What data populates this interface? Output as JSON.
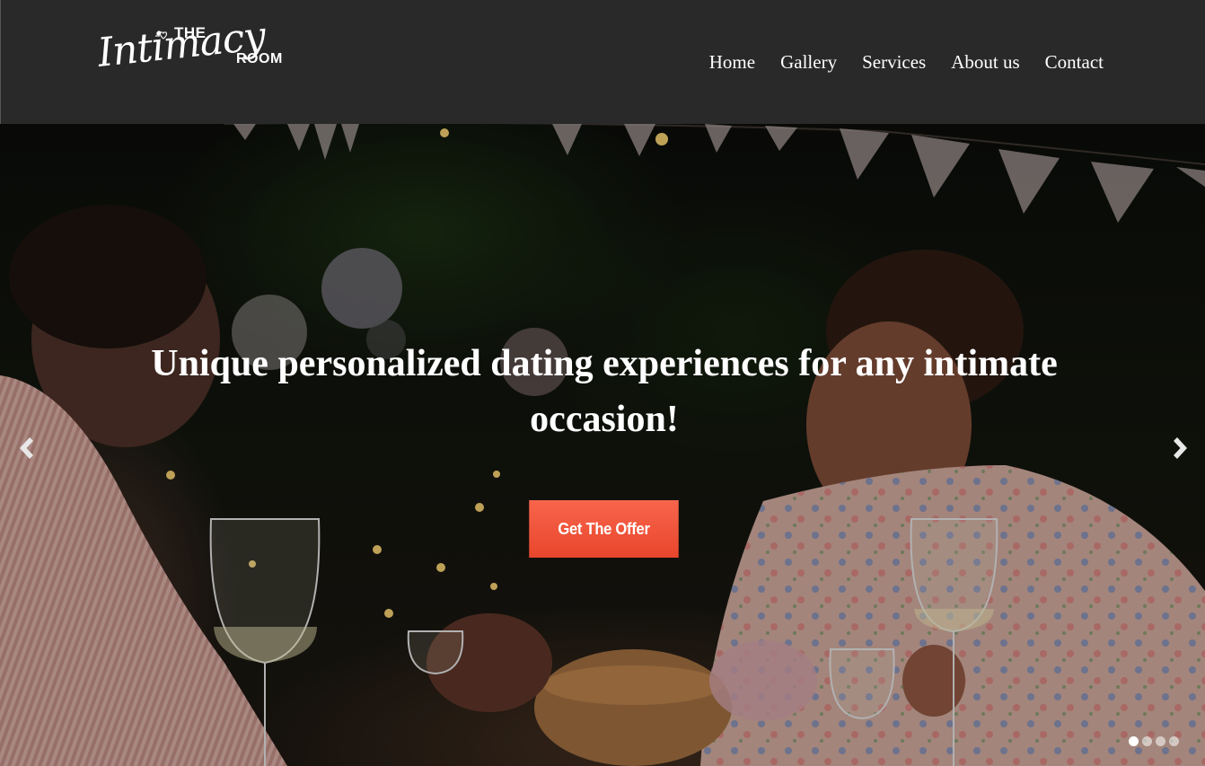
{
  "logo": {
    "the": "THE",
    "script": "Intimacy",
    "room": "ROOM"
  },
  "nav": {
    "items": [
      "Home",
      "Gallery",
      "Services",
      "About us",
      "Contact"
    ]
  },
  "hero": {
    "title": "Unique personalized dating experiences for any intimate occasion!",
    "cta_label": "Get The Offer",
    "slide_count": 4,
    "active_slide": 1
  },
  "icons": {
    "prev": "chevron-left-icon",
    "next": "chevron-right-icon",
    "logo_heart": "heart-icon"
  },
  "colors": {
    "header_bg": "#292929",
    "cta_bg": "#f25a3e",
    "text": "#ffffff"
  }
}
